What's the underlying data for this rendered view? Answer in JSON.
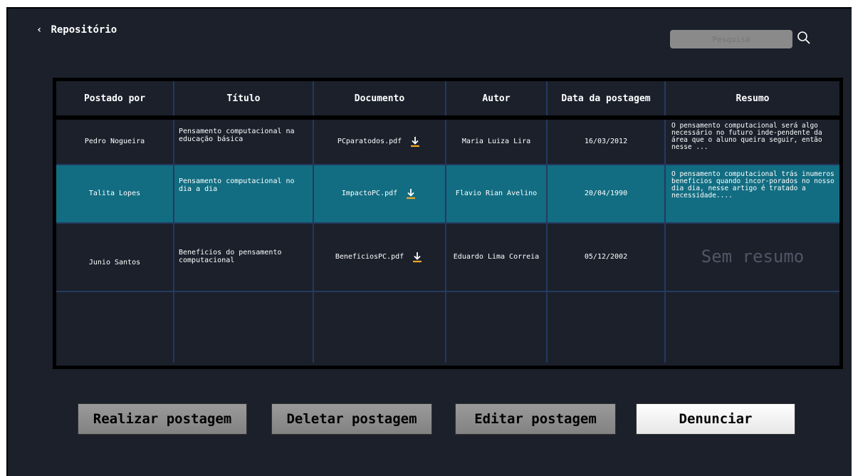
{
  "header": {
    "back_label": "Repositório",
    "back_icon": "chevron-left-icon"
  },
  "search": {
    "placeholder": "Pesquisa",
    "icon": "search-icon"
  },
  "table": {
    "columns": [
      "Postado por",
      "Título",
      "Documento",
      "Autor",
      "Data da postagem",
      "Resumo"
    ],
    "rows": [
      {
        "postado_por": "Pedro Nogueira",
        "titulo": "Pensamento computacional na educação básica",
        "documento": "PCparatodos.pdf",
        "autor": "Maria Luiza Lira",
        "data": "16/03/2012",
        "resumo": "O pensamento computacional será algo necessário no futuro inde-pendente da área que o aluno queira seguir, então nesse ...",
        "selected": false
      },
      {
        "postado_por": "Talita Lopes",
        "titulo": "Pensamento computacional no dia a dia",
        "documento": "ImpactoPC.pdf",
        "autor": "Flavio Rian Avelino",
        "data": "20/04/1990",
        "resumo": "O pensamento computacional trás inumeros beneficios quando incor-porados no nosso dia dia, nesse artigo é tratado a necessidade....",
        "selected": true
      },
      {
        "postado_por": "Junio Santos",
        "titulo": "Beneficios do pensamento computacional",
        "documento": "BeneficiosPC.pdf",
        "autor": "Eduardo Lima Correia",
        "data": "05/12/2002",
        "resumo": "Sem resumo",
        "selected": false
      }
    ]
  },
  "buttons": {
    "realizar": "Realizar postagem",
    "deletar": "Deletar postagem",
    "editar": "Editar postagem",
    "denunciar": "Denunciar"
  },
  "colors": {
    "background": "#1b202b",
    "selected_row": "#126d82",
    "grid": "#25395f",
    "download_icon": "#f5a623"
  }
}
